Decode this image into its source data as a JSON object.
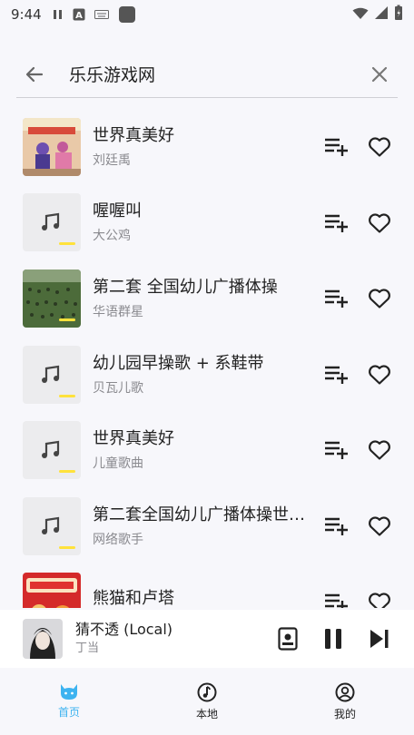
{
  "status_bar": {
    "time": "9:44"
  },
  "search": {
    "query": "乐乐游戏网",
    "placeholder": ""
  },
  "songs": [
    {
      "title": "世界真美好",
      "artist": "刘廷禹",
      "cover": "image"
    },
    {
      "title": "喔喔叫",
      "artist": "大公鸡",
      "cover": "default"
    },
    {
      "title": "第二套 全国幼儿广播体操",
      "artist": "华语群星",
      "cover": "image"
    },
    {
      "title": "幼儿园早操歌 + 系鞋带",
      "artist": "贝瓦儿歌",
      "cover": "default"
    },
    {
      "title": "世界真美好",
      "artist": "儿童歌曲",
      "cover": "default"
    },
    {
      "title": "第二套全国幼儿广播体操世…",
      "artist": "网络歌手",
      "cover": "default"
    },
    {
      "title": "熊猫和卢塔",
      "artist": "",
      "cover": "image"
    }
  ],
  "now_playing": {
    "title": "猜不透 (Local)",
    "artist": "丁当"
  },
  "nav": [
    {
      "label": "首页",
      "icon": "cat-icon",
      "active": true
    },
    {
      "label": "本地",
      "icon": "music-disc-icon",
      "active": false
    },
    {
      "label": "我的",
      "icon": "user-icon",
      "active": false
    }
  ],
  "colors": {
    "accent": "#3db3f0",
    "highlight_bar": "#ffe23b",
    "background": "#f7f7fb"
  }
}
